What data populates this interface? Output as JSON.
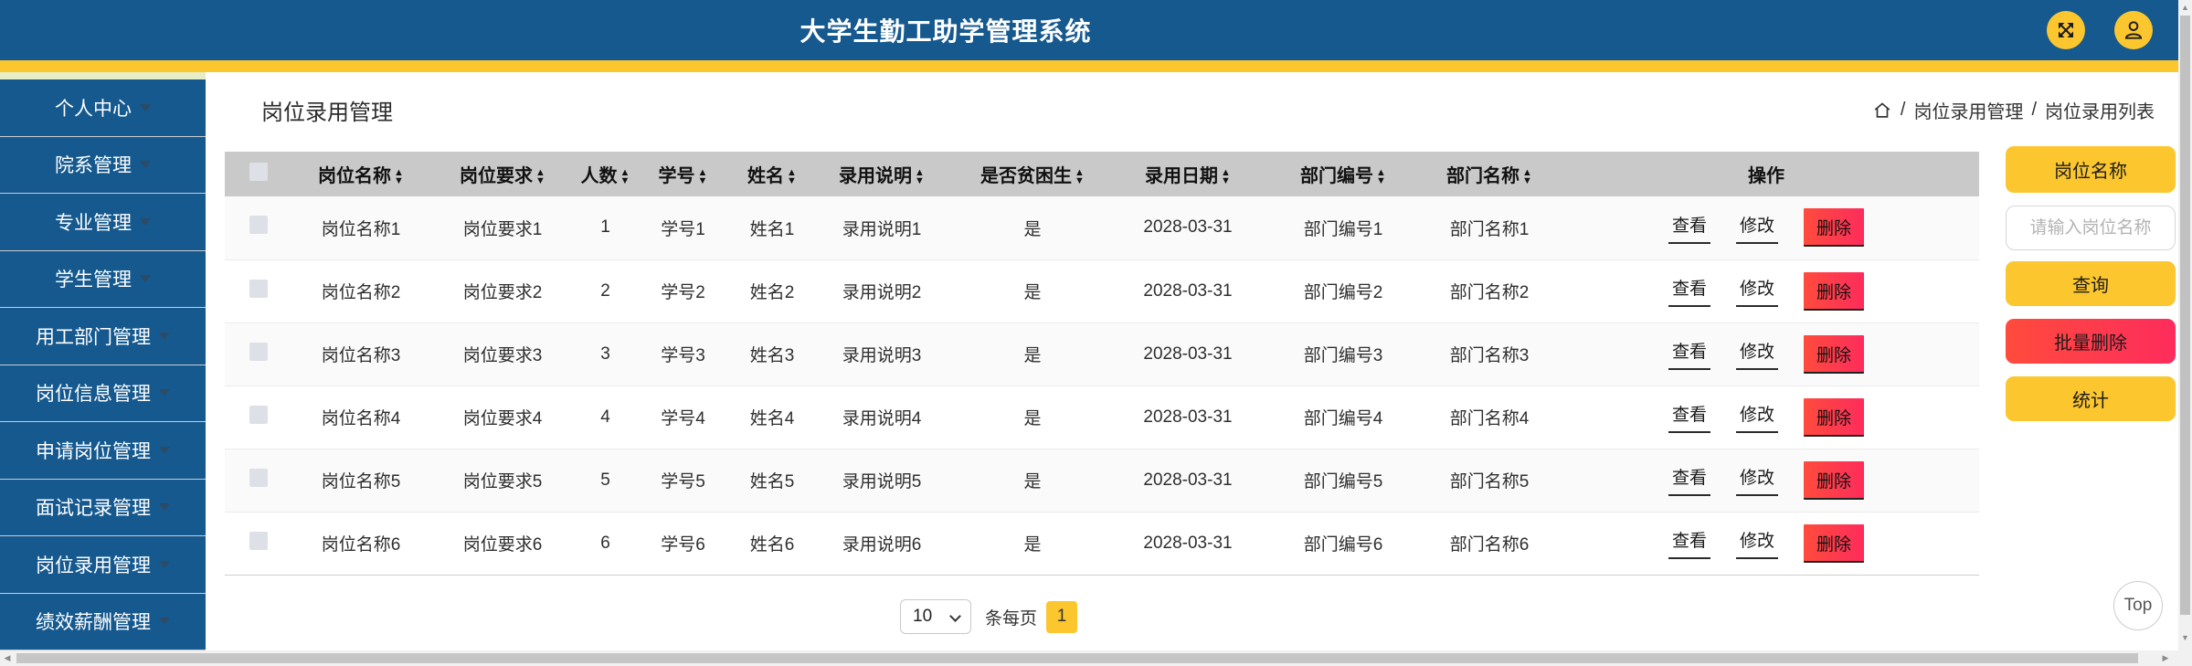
{
  "colors": {
    "header_blue": "#15598f",
    "accent_yellow": "#fcc62f",
    "pale_strip": "#e9edc6",
    "header_row_gray": "#c9c9c9",
    "delete_grad_1": "#ff4b3c",
    "delete_grad_2": "#fe2c5c"
  },
  "icons": {
    "sort_asc": "▲",
    "sort_desc": "▼",
    "scroll_up": "▲",
    "scroll_down": "▼",
    "scroll_left": "◀",
    "scroll_right": "▶"
  },
  "header": {
    "title": "大学生勤工助学管理系统"
  },
  "sidebar": {
    "items": [
      {
        "key": "personal-center",
        "label": "个人中心"
      },
      {
        "key": "faculty-management",
        "label": "院系管理"
      },
      {
        "key": "major-management",
        "label": "专业管理"
      },
      {
        "key": "student-management",
        "label": "学生管理"
      },
      {
        "key": "employer-department-management",
        "label": "用工部门管理"
      },
      {
        "key": "job-info-management",
        "label": "岗位信息管理"
      },
      {
        "key": "job-application-management",
        "label": "申请岗位管理"
      },
      {
        "key": "interview-record-management",
        "label": "面试记录管理"
      },
      {
        "key": "job-hiring-management",
        "label": "岗位录用管理"
      },
      {
        "key": "performance-salary-management",
        "label": "绩效薪酬管理"
      }
    ]
  },
  "page": {
    "title": "岗位录用管理",
    "breadcrumb": {
      "separator": "/",
      "items": [
        "岗位录用管理",
        "岗位录用列表"
      ]
    }
  },
  "table": {
    "columns": [
      {
        "key": "select",
        "label": "",
        "type": "checkbox",
        "sortable": false
      },
      {
        "key": "post-name",
        "label": "岗位名称",
        "field": "post_name",
        "type": "text",
        "sortable": true
      },
      {
        "key": "post-requirement",
        "label": "岗位要求",
        "field": "requirement",
        "type": "text",
        "sortable": true
      },
      {
        "key": "headcount",
        "label": "人数",
        "field": "headcount",
        "type": "text",
        "sortable": true
      },
      {
        "key": "student-id",
        "label": "学号",
        "field": "student_id",
        "type": "text",
        "sortable": true
      },
      {
        "key": "student-name",
        "label": "姓名",
        "field": "student_name",
        "type": "text",
        "sortable": true
      },
      {
        "key": "hire-note",
        "label": "录用说明",
        "field": "note",
        "type": "text",
        "sortable": true
      },
      {
        "key": "is-poor-student",
        "label": "是否贫困生",
        "field": "poor",
        "type": "text",
        "sortable": true
      },
      {
        "key": "hire-date",
        "label": "录用日期",
        "field": "date",
        "type": "text",
        "sortable": true
      },
      {
        "key": "dept-id",
        "label": "部门编号",
        "field": "dept_id",
        "type": "text",
        "sortable": true
      },
      {
        "key": "dept-name",
        "label": "部门名称",
        "field": "dept_name",
        "type": "text",
        "sortable": true
      },
      {
        "key": "actions",
        "label": "操作",
        "type": "actions",
        "sortable": false
      }
    ],
    "rows": [
      {
        "post_name": "岗位名称1",
        "requirement": "岗位要求1",
        "headcount": "1",
        "student_id": "学号1",
        "student_name": "姓名1",
        "note": "录用说明1",
        "poor": "是",
        "date": "2028-03-31",
        "dept_id": "部门编号1",
        "dept_name": "部门名称1"
      },
      {
        "post_name": "岗位名称2",
        "requirement": "岗位要求2",
        "headcount": "2",
        "student_id": "学号2",
        "student_name": "姓名2",
        "note": "录用说明2",
        "poor": "是",
        "date": "2028-03-31",
        "dept_id": "部门编号2",
        "dept_name": "部门名称2"
      },
      {
        "post_name": "岗位名称3",
        "requirement": "岗位要求3",
        "headcount": "3",
        "student_id": "学号3",
        "student_name": "姓名3",
        "note": "录用说明3",
        "poor": "是",
        "date": "2028-03-31",
        "dept_id": "部门编号3",
        "dept_name": "部门名称3"
      },
      {
        "post_name": "岗位名称4",
        "requirement": "岗位要求4",
        "headcount": "4",
        "student_id": "学号4",
        "student_name": "姓名4",
        "note": "录用说明4",
        "poor": "是",
        "date": "2028-03-31",
        "dept_id": "部门编号4",
        "dept_name": "部门名称4"
      },
      {
        "post_name": "岗位名称5",
        "requirement": "岗位要求5",
        "headcount": "5",
        "student_id": "学号5",
        "student_name": "姓名5",
        "note": "录用说明5",
        "poor": "是",
        "date": "2028-03-31",
        "dept_id": "部门编号5",
        "dept_name": "部门名称5"
      },
      {
        "post_name": "岗位名称6",
        "requirement": "岗位要求6",
        "headcount": "6",
        "student_id": "学号6",
        "student_name": "姓名6",
        "note": "录用说明6",
        "poor": "是",
        "date": "2028-03-31",
        "dept_id": "部门编号6",
        "dept_name": "部门名称6"
      }
    ],
    "actions": {
      "view": "查看",
      "edit": "修改",
      "delete": "删除"
    }
  },
  "panel": {
    "field_button": "岗位名称",
    "search_placeholder": "请输入岗位名称",
    "query_button": "查询",
    "batch_delete_button": "批量删除",
    "stats_button": "统计"
  },
  "pagination": {
    "page_size": "10",
    "per_page_label": "条每页",
    "current_page": "1"
  },
  "misc": {
    "top_label": "Top"
  }
}
